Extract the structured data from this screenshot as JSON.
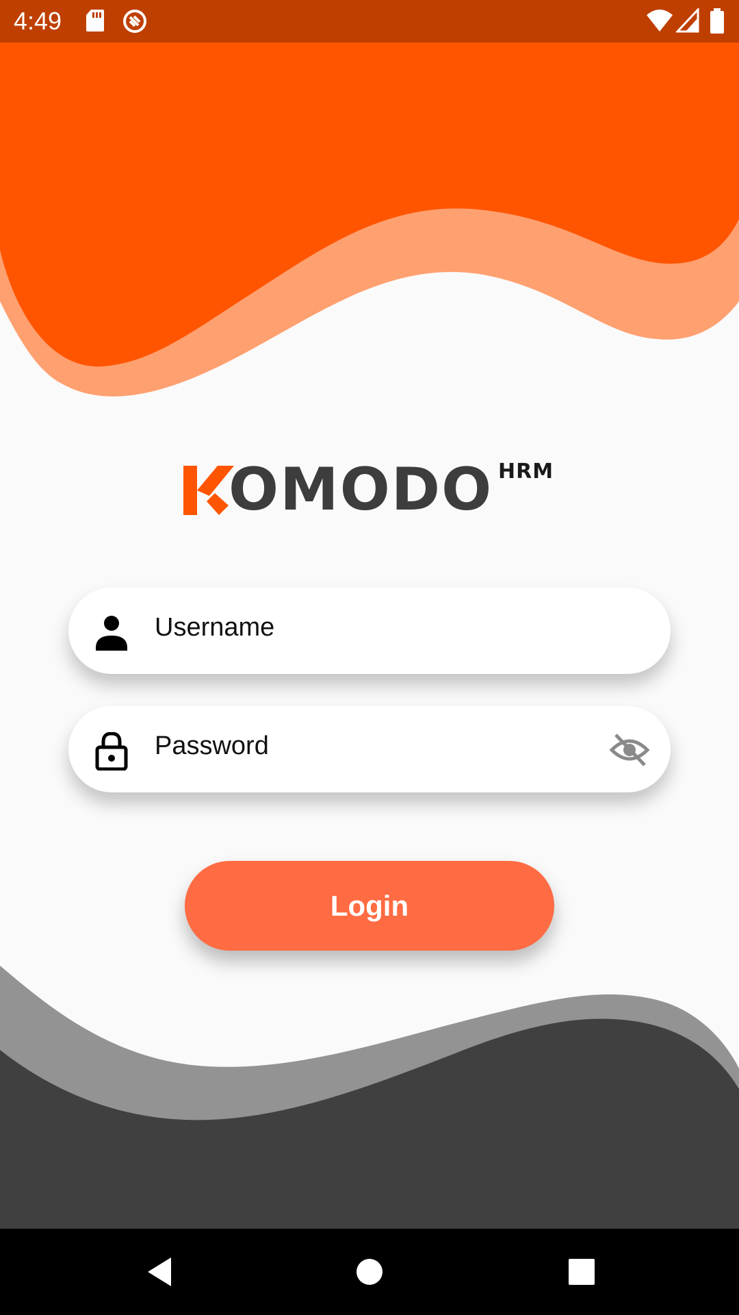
{
  "status_bar": {
    "time": "4:49",
    "icons": [
      "sd-card-icon",
      "sync-off-icon",
      "wifi-icon",
      "signal-icon",
      "battery-icon"
    ]
  },
  "logo": {
    "wordmark": "OMODO",
    "superscript": "HRM"
  },
  "form": {
    "username": {
      "placeholder": "Username",
      "value": "",
      "icon": "person-icon"
    },
    "password": {
      "placeholder": "Password",
      "value": "",
      "icon": "lock-icon",
      "toggle_icon": "eye-off-icon"
    },
    "login_label": "Login"
  },
  "nav_bar": {
    "buttons": [
      "back-icon",
      "home-icon",
      "recents-icon"
    ]
  },
  "colors": {
    "status_bar": "#bf3f00",
    "wave_orange": "#ff5500",
    "wave_orange_light": "#ffa070",
    "wave_gray_light": "#939393",
    "wave_gray_dark": "#404040",
    "button": "#ff6b42",
    "background": "#fafafa"
  }
}
